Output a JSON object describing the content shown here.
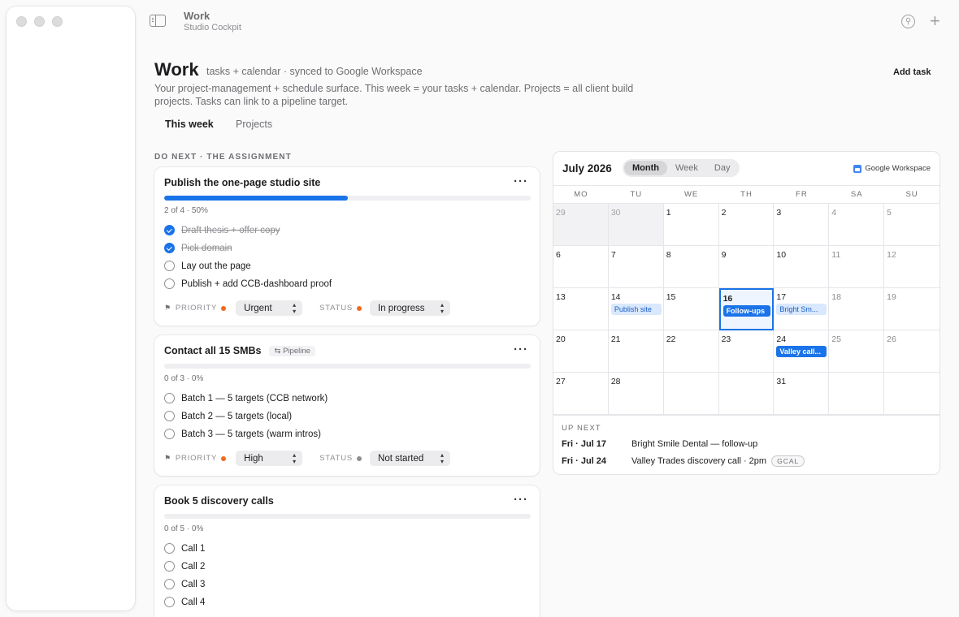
{
  "window": {
    "title": "Work",
    "subtitle": "Studio Cockpit"
  },
  "page": {
    "title": "Work",
    "tagline": "tasks + calendar · synced to Google Workspace",
    "description": "Your project-management + schedule surface. This week = your tasks + calendar. Projects = all client build projects. Tasks can link to a pipeline target.",
    "add_task": "Add task",
    "tabs": [
      {
        "label": "This week",
        "active": true
      },
      {
        "label": "Projects",
        "active": false
      }
    ],
    "section_label": "DO NEXT · THE ASSIGNMENT"
  },
  "labels": {
    "priority": "PRIORITY",
    "status": "STATUS",
    "more": "···"
  },
  "tasks": [
    {
      "title": "Publish the one-page studio site",
      "progress_value": 0.5,
      "progress_text": "2 of 4 · 50%",
      "items": [
        {
          "label": "Draft thesis + offer copy",
          "done": true
        },
        {
          "label": "Pick domain",
          "done": true
        },
        {
          "label": "Lay out the page",
          "done": false
        },
        {
          "label": "Publish + add CCB-dashboard proof",
          "done": false
        }
      ],
      "priority": "Urgent",
      "priority_color": "#f26b1d",
      "status": "In progress",
      "status_color": "#f26b1d"
    },
    {
      "title": "Contact all 15 SMBs",
      "pill": "Pipeline",
      "progress_value": 0,
      "progress_text": "0 of 3 · 0%",
      "items": [
        {
          "label": "Batch 1 — 5 targets (CCB network)",
          "done": false
        },
        {
          "label": "Batch 2 — 5 targets (local)",
          "done": false
        },
        {
          "label": "Batch 3 — 5 targets (warm intros)",
          "done": false
        }
      ],
      "priority": "High",
      "priority_color": "#f26b1d",
      "status": "Not started",
      "status_color": "#8e8e93"
    },
    {
      "title": "Book 5 discovery calls",
      "progress_value": 0,
      "progress_text": "0 of 5 · 0%",
      "items": [
        {
          "label": "Call 1",
          "done": false
        },
        {
          "label": "Call 2",
          "done": false
        },
        {
          "label": "Call 3",
          "done": false
        },
        {
          "label": "Call 4",
          "done": false
        }
      ]
    }
  ],
  "calendar": {
    "month_label": "July 2026",
    "views": [
      {
        "label": "Month",
        "active": true
      },
      {
        "label": "Week",
        "active": false
      },
      {
        "label": "Day",
        "active": false
      }
    ],
    "source": "Google Workspace",
    "weekdays": [
      "MO",
      "TU",
      "WE",
      "TH",
      "FR",
      "SA",
      "SU"
    ],
    "cells": [
      {
        "day": "29",
        "other": true
      },
      {
        "day": "30",
        "other": true
      },
      {
        "day": "1"
      },
      {
        "day": "2"
      },
      {
        "day": "3"
      },
      {
        "day": "4",
        "weekend": true
      },
      {
        "day": "5",
        "weekend": true
      },
      {
        "day": "6"
      },
      {
        "day": "7"
      },
      {
        "day": "8"
      },
      {
        "day": "9"
      },
      {
        "day": "10"
      },
      {
        "day": "11",
        "weekend": true
      },
      {
        "day": "12",
        "weekend": true
      },
      {
        "day": "13"
      },
      {
        "day": "14",
        "event": "Publish site",
        "event_style": "light"
      },
      {
        "day": "15"
      },
      {
        "day": "16",
        "today": true,
        "event": "Follow-ups",
        "event_style": "solid"
      },
      {
        "day": "17",
        "event": "Bright Sm...",
        "event_style": "light"
      },
      {
        "day": "18",
        "weekend": true
      },
      {
        "day": "19",
        "weekend": true
      },
      {
        "day": "20"
      },
      {
        "day": "21"
      },
      {
        "day": "22"
      },
      {
        "day": "23"
      },
      {
        "day": "24",
        "event": "Valley call...",
        "event_style": "solid"
      },
      {
        "day": "25",
        "weekend": true
      },
      {
        "day": "26",
        "weekend": true
      },
      {
        "day": "27"
      },
      {
        "day": "28"
      },
      {
        "day": ""
      },
      {
        "day": ""
      },
      {
        "day": "31"
      },
      {
        "day": ""
      },
      {
        "day": ""
      }
    ],
    "up_next_label": "UP NEXT",
    "up_next": [
      {
        "date": "Fri · Jul 17",
        "title": "Bright Smile Dental — follow-up"
      },
      {
        "date": "Fri · Jul 24",
        "title": "Valley Trades discovery call · 2pm",
        "badge": "GCAL"
      }
    ]
  },
  "icons": {
    "sidebar_toggle": "sidebar-toggle-icon",
    "pin": "pin-icon",
    "add": "plus-icon",
    "flag": "flag-icon",
    "chevron": "chevron-updown-icon",
    "calendar": "google-calendar-icon"
  }
}
